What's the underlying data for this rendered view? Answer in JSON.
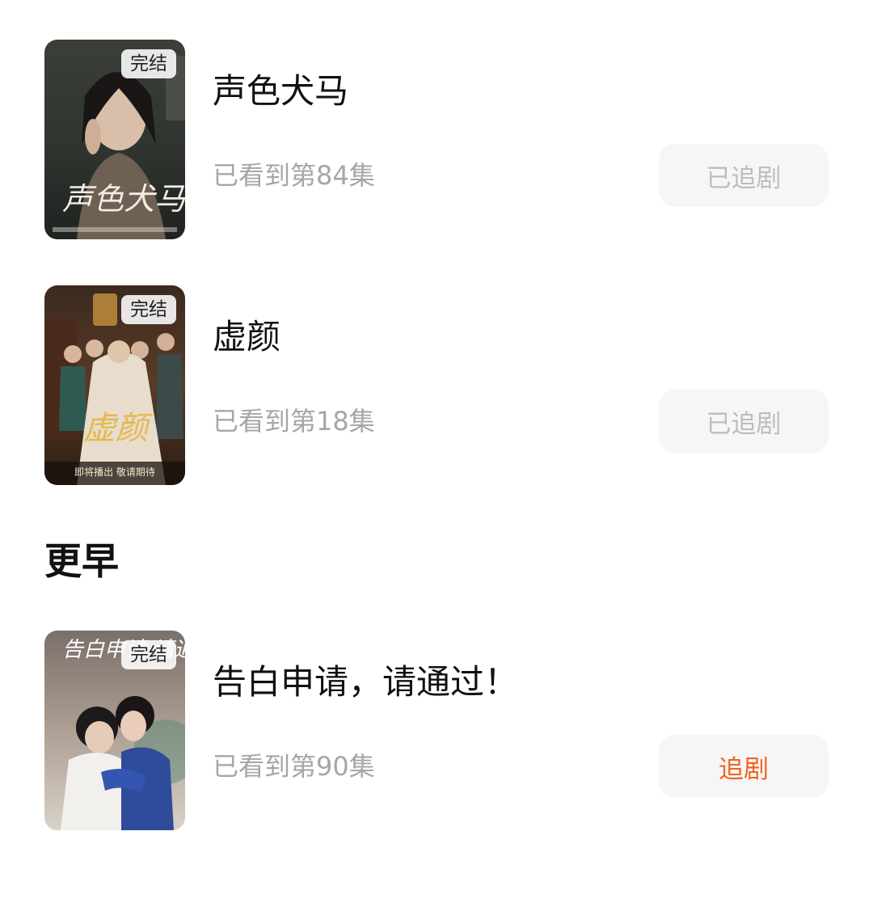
{
  "colors": {
    "accent": "#f2621f",
    "muted_text": "#a6a6a6",
    "button_bg": "#f6f6f6",
    "followed_text": "#bdbdbd"
  },
  "recent_items": [
    {
      "title": "声色犬马",
      "status_badge": "完结",
      "progress": "已看到第84集",
      "follow_label": "已追剧",
      "followed": true,
      "poster_title": "声色犬马",
      "poster_icon": "poster-image"
    },
    {
      "title": "虚颜",
      "status_badge": "完结",
      "progress": "已看到第18集",
      "follow_label": "已追剧",
      "followed": true,
      "poster_title": "虚颜",
      "poster_caption": "即将播出 敬请期待",
      "poster_icon": "poster-image"
    }
  ],
  "earlier_section": {
    "heading": "更早",
    "items": [
      {
        "title": "告白申请，请通过！",
        "status_badge": "完结",
        "progress": "已看到第90集",
        "follow_label": "追剧",
        "followed": false,
        "poster_title": "告白申请 请通过",
        "poster_icon": "poster-image"
      }
    ]
  }
}
